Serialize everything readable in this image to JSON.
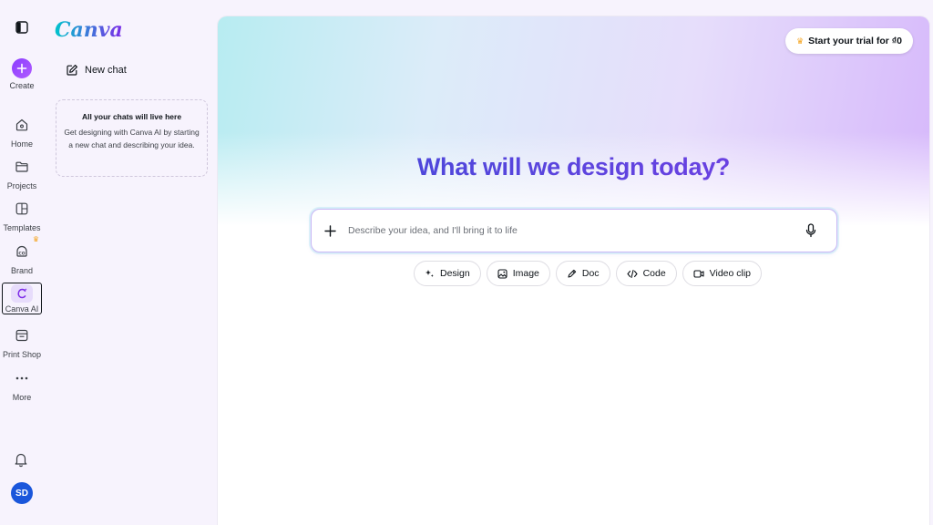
{
  "brand": {
    "logo_text": "Canva"
  },
  "rail": {
    "items": [
      {
        "id": "create",
        "label": "Create",
        "icon": "plus-icon"
      },
      {
        "id": "home",
        "label": "Home",
        "icon": "home-icon"
      },
      {
        "id": "projects",
        "label": "Projects",
        "icon": "folder-icon"
      },
      {
        "id": "templates",
        "label": "Templates",
        "icon": "templates-icon"
      },
      {
        "id": "brand",
        "label": "Brand",
        "icon": "brand-icon"
      },
      {
        "id": "canva-ai",
        "label": "Canva AI",
        "icon": "canva-ai-icon",
        "selected": true
      },
      {
        "id": "print-shop",
        "label": "Print Shop",
        "icon": "store-icon"
      },
      {
        "id": "more",
        "label": "More",
        "icon": "more-dots-icon"
      }
    ],
    "avatar_initials": "SD"
  },
  "chat_panel": {
    "new_chat_label": "New chat",
    "empty_title": "All your chats will live here",
    "empty_description": "Get designing with Canva AI by starting a new chat and describing your idea."
  },
  "main": {
    "trial_button": "Start your trial for ₫0",
    "headline": "What will we design today?",
    "prompt_placeholder": "Describe your idea, and I'll bring it to life",
    "prompt_value": "",
    "chips": [
      {
        "label": "Design",
        "icon": "sparkle-icon"
      },
      {
        "label": "Image",
        "icon": "image-icon"
      },
      {
        "label": "Doc",
        "icon": "pen-icon"
      },
      {
        "label": "Code",
        "icon": "code-icon"
      },
      {
        "label": "Video clip",
        "icon": "video-icon"
      }
    ]
  },
  "colors": {
    "accent": "#8b3dff",
    "headline_start": "#3d4bd6",
    "headline_end": "#7b3de6",
    "avatar": "#1a56db",
    "crown": "#f5a623"
  }
}
